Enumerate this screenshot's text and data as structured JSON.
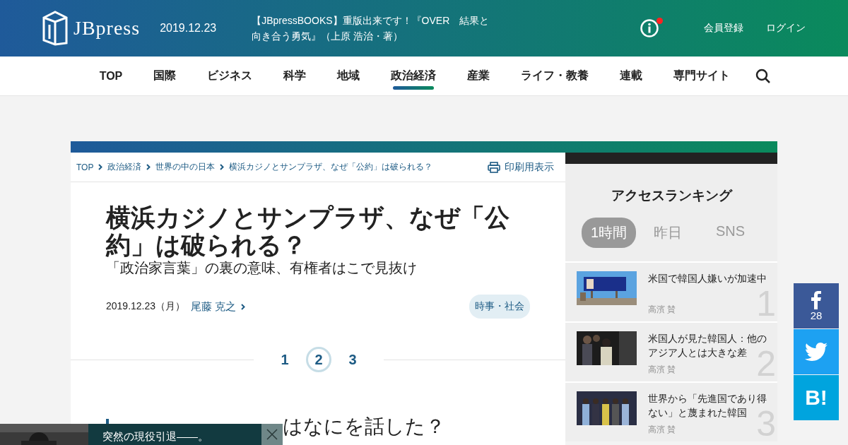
{
  "header": {
    "logo": "JBpress",
    "date": "2019.12.23",
    "notice": "【JBpressBOOKS】重版出来です！『OVER　結果と向き合う勇気』（上原 浩治・著）",
    "has_notification": true,
    "links": [
      "会員登録",
      "ログイン"
    ]
  },
  "nav": [
    {
      "label": "TOP",
      "selected": false
    },
    {
      "label": "国際",
      "selected": false
    },
    {
      "label": "ビジネス",
      "selected": false
    },
    {
      "label": "科学",
      "selected": false
    },
    {
      "label": "地域",
      "selected": false
    },
    {
      "label": "政治経済",
      "selected": true
    },
    {
      "label": "産業",
      "selected": false
    },
    {
      "label": "ライフ・教養",
      "selected": false
    },
    {
      "label": "連載",
      "selected": false
    },
    {
      "label": "専門サイト",
      "selected": false
    }
  ],
  "breadcrumb": [
    "TOP",
    "政治経済",
    "世界の中の日本",
    "横浜カジノとサンプラザ、なぜ「公約」は破られる？"
  ],
  "print_link": "印刷用表示",
  "article": {
    "title": "横浜カジノとサンプラザ、なぜ「公約」は破られる？",
    "subtitle": "「政治家言葉」の裏の意味、有権者はこで見抜け",
    "date": "2019.12.23（月）",
    "author": "尾藤 克之",
    "tag": "時事・社会",
    "pages": [
      {
        "label": "1",
        "selected": false
      },
      {
        "label": "2",
        "selected": true
      },
      {
        "label": "3",
        "selected": false
      }
    ],
    "heading": "はなにを話した？"
  },
  "ranking": {
    "title": "アクセスランキング",
    "tabs": [
      {
        "label": "1時間",
        "selected": true
      },
      {
        "label": "昨日",
        "selected": false
      },
      {
        "label": "SNS",
        "selected": false
      }
    ],
    "items": [
      {
        "title": "米国で韓国人嫌いが加速中",
        "author": "高濱 賛",
        "rank": "1"
      },
      {
        "title": "米国人が見た韓国人：他のアジア人とは大きな差",
        "author": "高濱 賛",
        "rank": "2"
      },
      {
        "title": "世界から「先進国であり得ない」と蔑まれた韓国",
        "author": "高濱 賛",
        "rank": "3"
      }
    ]
  },
  "share": {
    "facebook_count": "28",
    "hatena": "B!"
  },
  "ad": {
    "text": "突然の現役引退――。"
  }
}
